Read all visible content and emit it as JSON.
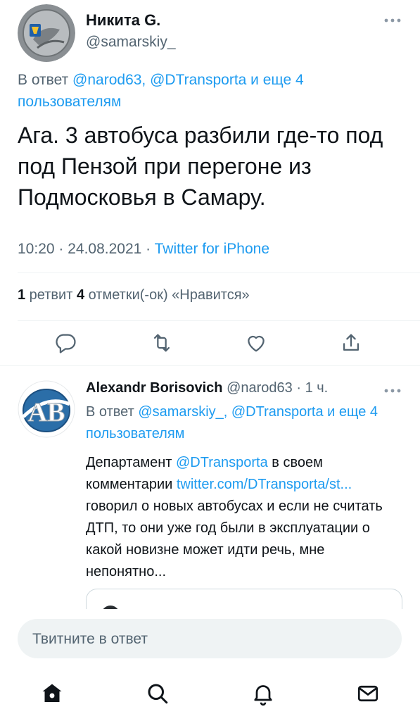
{
  "tweet": {
    "author_name": "Никита G.",
    "author_handle": "@samarskiy_",
    "reply_prefix": "В ответ ",
    "reply_targets": "@narod63, @DTransporta и еще 4 пользователям",
    "text": "Ага. 3 автобуса разбили где-то под под Пензой при перегоне из Подмосковья в Самару.",
    "time": "10:20 · 24.08.2021 · ",
    "source": "Twitter for iPhone",
    "retweet_count": "1",
    "retweet_label": " ретвит ",
    "like_count": "4",
    "like_label": " отметки(-ок) «Нравится»",
    "actions": [
      "reply-icon",
      "retweet-icon",
      "like-icon",
      "share-icon"
    ]
  },
  "reply": {
    "author_name": "Alexandr Borisovich",
    "author_handle": "@narod63",
    "time": "1 ч.",
    "avatar_text": "AB",
    "reply_prefix": "В ответ ",
    "reply_targets": "@samarskiy_, @DTransporta и еще 4 пользователям",
    "text_part1": "Департамент ",
    "mention": "@DTransporta",
    "text_part2": " в своем комментарии ",
    "url": "twitter.com/DTransporta/st...",
    "text_part3": " говорил о новых автобусах и если не считать ДТП, то они уже год были в эксплуатации о какой новизне может идти речь, мне непонятно..."
  },
  "composer": {
    "placeholder": "Твитните в ответ"
  },
  "tabbar": {
    "items": [
      "home-icon",
      "search-icon",
      "notifications-icon",
      "messages-icon"
    ]
  },
  "colors": {
    "accent": "#1d9bf0",
    "muted": "#536471",
    "text": "#0f1419"
  }
}
